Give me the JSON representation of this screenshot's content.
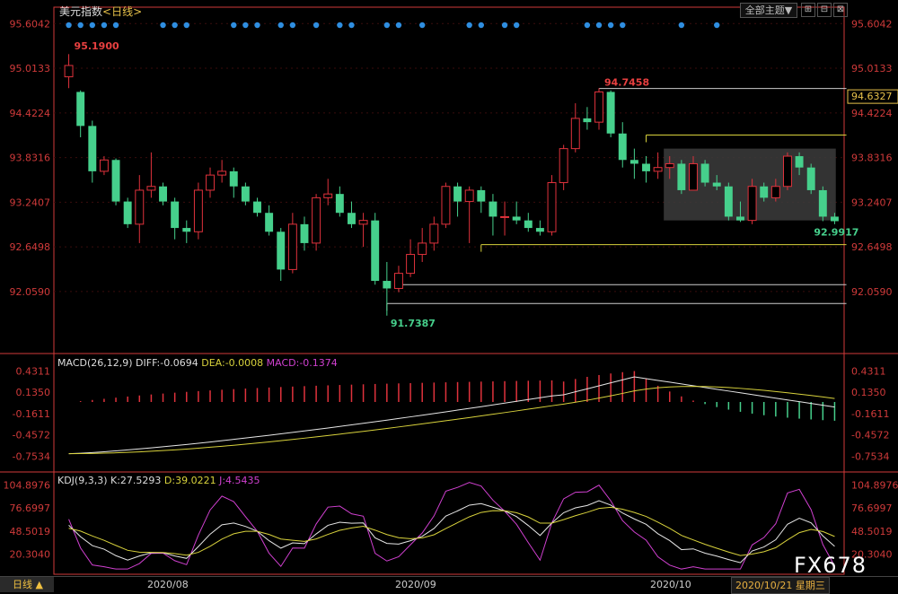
{
  "header": {
    "instrument": "美元指数",
    "period": "<日线>",
    "theme_button": "全部主题▼",
    "win_buttons": [
      "⊞",
      "⊟",
      "⊠"
    ]
  },
  "price_axis": {
    "labels": [
      "95.6042",
      "95.0133",
      "94.4224",
      "93.8316",
      "93.2407",
      "92.6498",
      "92.0590"
    ],
    "min": 91.5,
    "max": 95.75,
    "current": "94.6327"
  },
  "annotations": {
    "high": "95.1900",
    "mid_high": "94.7458",
    "low": "91.7387",
    "last_low": "92.9917"
  },
  "macd": {
    "label": "MACD(26,12,9)",
    "diff": "DIFF:-0.0694",
    "dea": "DEA:-0.0008",
    "macd": "MACD:-0.1374",
    "axis_labels": [
      "0.4311",
      "0.1350",
      "-0.1611",
      "-0.4572",
      "-0.7534"
    ],
    "min": -0.85,
    "max": 0.5
  },
  "kdj": {
    "label": "KDJ(9,3,3)",
    "k": "K:27.5293",
    "d": "D:39.0221",
    "j": "J:4.5435",
    "axis_labels": [
      "104.8976",
      "76.6997",
      "48.5019",
      "20.3040"
    ],
    "min": 0,
    "max": 112
  },
  "bottom": {
    "period_tab": "日线 ▲",
    "dates": [
      "2020/08",
      "2020/09",
      "2020/10"
    ],
    "current_date": "2020/10/21 星期三"
  },
  "watermark": "FX678",
  "colors": {
    "up": "#e0323c",
    "down": "#46d08c",
    "diff": "#e6e6e6",
    "dea": "#d8d23c",
    "macd": "#d040d0",
    "k": "#e6e6e6",
    "d": "#d8d23c",
    "j": "#d040d0",
    "axis": "#d03a3a"
  },
  "chart_data": {
    "type": "candlestick",
    "dates_shown": [
      "2020/08",
      "2020/09",
      "2020/10"
    ],
    "candles": [
      [
        94.9,
        95.05,
        95.2,
        94.75
      ],
      [
        94.7,
        94.25,
        94.72,
        94.1
      ],
      [
        94.25,
        93.65,
        94.32,
        93.5
      ],
      [
        93.65,
        93.8,
        93.85,
        93.6
      ],
      [
        93.8,
        93.25,
        93.82,
        93.2
      ],
      [
        93.25,
        92.95,
        93.3,
        92.9
      ],
      [
        92.95,
        93.4,
        93.6,
        92.7
      ],
      [
        93.4,
        93.45,
        93.9,
        93.3
      ],
      [
        93.45,
        93.25,
        93.5,
        93.2
      ],
      [
        93.25,
        92.9,
        93.3,
        92.75
      ],
      [
        92.9,
        92.85,
        93.0,
        92.7
      ],
      [
        92.85,
        93.4,
        93.5,
        92.75
      ],
      [
        93.4,
        93.6,
        93.7,
        93.3
      ],
      [
        93.6,
        93.65,
        93.8,
        93.5
      ],
      [
        93.65,
        93.45,
        93.7,
        93.3
      ],
      [
        93.45,
        93.25,
        93.5,
        93.2
      ],
      [
        93.25,
        93.1,
        93.3,
        93.05
      ],
      [
        93.1,
        92.85,
        93.2,
        92.8
      ],
      [
        92.85,
        92.35,
        92.9,
        92.2
      ],
      [
        92.35,
        92.95,
        93.1,
        92.3
      ],
      [
        92.95,
        92.7,
        93.05,
        92.6
      ],
      [
        92.7,
        93.3,
        93.35,
        92.6
      ],
      [
        93.3,
        93.35,
        93.55,
        93.2
      ],
      [
        93.35,
        93.1,
        93.45,
        93.05
      ],
      [
        93.1,
        92.95,
        93.25,
        92.9
      ],
      [
        92.95,
        93.0,
        93.1,
        92.65
      ],
      [
        93.0,
        92.2,
        93.1,
        92.15
      ],
      [
        92.2,
        92.1,
        92.45,
        91.74
      ],
      [
        92.1,
        92.3,
        92.4,
        92.05
      ],
      [
        92.3,
        92.55,
        92.75,
        92.25
      ],
      [
        92.55,
        92.7,
        92.9,
        92.45
      ],
      [
        92.7,
        92.95,
        93.05,
        92.6
      ],
      [
        92.95,
        93.45,
        93.5,
        92.9
      ],
      [
        93.45,
        93.25,
        93.5,
        93.05
      ],
      [
        93.25,
        93.4,
        93.45,
        92.7
      ],
      [
        93.4,
        93.25,
        93.45,
        93.1
      ],
      [
        93.25,
        93.05,
        93.35,
        92.8
      ],
      [
        93.05,
        93.05,
        93.25,
        92.8
      ],
      [
        93.05,
        93.0,
        93.25,
        92.95
      ],
      [
        93.0,
        92.9,
        93.1,
        92.85
      ],
      [
        92.9,
        92.85,
        93.0,
        92.8
      ],
      [
        92.85,
        93.5,
        93.6,
        92.8
      ],
      [
        93.5,
        93.95,
        94.0,
        93.4
      ],
      [
        93.95,
        94.35,
        94.55,
        93.9
      ],
      [
        94.35,
        94.3,
        94.5,
        94.2
      ],
      [
        94.3,
        94.7,
        94.75,
        94.2
      ],
      [
        94.7,
        94.15,
        94.72,
        94.1
      ],
      [
        94.15,
        93.8,
        94.3,
        93.7
      ],
      [
        93.8,
        93.75,
        93.95,
        93.55
      ],
      [
        93.75,
        93.65,
        93.85,
        93.5
      ],
      [
        93.65,
        93.7,
        93.9,
        93.55
      ],
      [
        93.7,
        93.75,
        93.85,
        93.55
      ],
      [
        93.75,
        93.4,
        93.8,
        93.35
      ],
      [
        93.4,
        93.75,
        93.85,
        93.4
      ],
      [
        93.75,
        93.5,
        93.8,
        93.45
      ],
      [
        93.5,
        93.45,
        93.6,
        93.4
      ],
      [
        93.45,
        93.05,
        93.5,
        93.0
      ],
      [
        93.05,
        93.0,
        93.25,
        92.98
      ],
      [
        93.0,
        93.45,
        93.55,
        92.95
      ],
      [
        93.45,
        93.3,
        93.5,
        93.25
      ],
      [
        93.3,
        93.45,
        93.55,
        93.25
      ],
      [
        93.45,
        93.85,
        93.9,
        93.4
      ],
      [
        93.85,
        93.7,
        93.9,
        93.6
      ],
      [
        93.7,
        93.4,
        93.75,
        93.35
      ],
      [
        93.4,
        93.05,
        93.45,
        92.99
      ],
      [
        93.05,
        92.99,
        93.1,
        92.95
      ]
    ],
    "levels": [
      {
        "value": 94.7458,
        "from": 45,
        "to": 65,
        "color": "#cccccc"
      },
      {
        "value": 94.13,
        "from": 49,
        "to": 65,
        "color": "#d8d23c"
      },
      {
        "value": 92.68,
        "from": 35,
        "to": 65,
        "color": "#d8d23c"
      },
      {
        "value": 92.15,
        "from": 28,
        "to": 65,
        "color": "#cccccc"
      },
      {
        "value": 91.9,
        "from": 27,
        "to": 65,
        "color": "#cccccc"
      }
    ],
    "box": {
      "from": 51,
      "to": 65,
      "top": 93.95,
      "bottom": 93.0
    },
    "signal_dots": [
      0,
      1,
      2,
      3,
      4,
      8,
      9,
      10,
      14,
      15,
      16,
      18,
      19,
      21,
      23,
      24,
      27,
      28,
      30,
      34,
      35,
      37,
      38,
      44,
      45,
      46,
      47,
      52,
      55
    ]
  }
}
